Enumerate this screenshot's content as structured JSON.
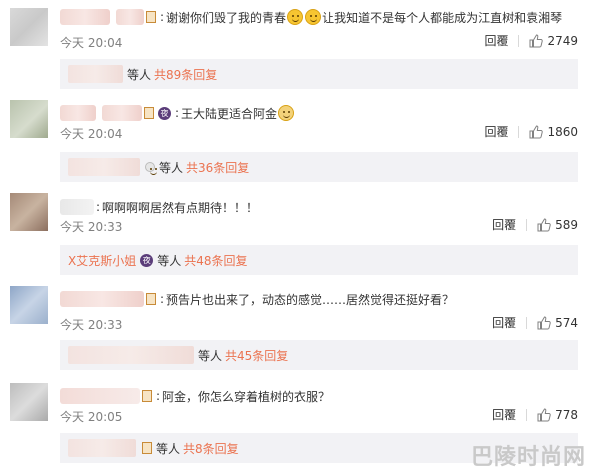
{
  "comments": [
    {
      "text": "谢谢你们毁了我的青春",
      "text2": "让我知道不是每个人都能成为江直树和袁湘琴",
      "time": "今天 20:04",
      "reply": "回覆",
      "likes": "2749",
      "sub_people": "等人",
      "sub_count": "共89条回复"
    },
    {
      "text": "王大陆更适合阿金",
      "time": "今天 20:04",
      "reply": "回覆",
      "likes": "1860",
      "sub_people": "等人",
      "sub_count": "共36条回复"
    },
    {
      "text": "啊啊啊啊居然有点期待！！！",
      "time": "今天 20:33",
      "reply": "回覆",
      "likes": "589",
      "sub_name": "X艾克斯小姐",
      "sub_people": "等人",
      "sub_count": "共48条回复"
    },
    {
      "text": "预告片也出来了，动态的感觉……居然觉得还挺好看？",
      "time": "今天 20:33",
      "reply": "回覆",
      "likes": "574",
      "sub_people": "等人",
      "sub_count": "共45条回复"
    },
    {
      "text": "阿金，你怎么穿着植树的衣服？",
      "time": "今天 20:05",
      "reply": "回覆",
      "likes": "778",
      "sub_people": "等人",
      "sub_count": "共8条回复"
    }
  ],
  "badge_text": "夜",
  "watermark": "巴陵时尚网",
  "colors": {
    "accent": "#eb7350",
    "muted": "#808080",
    "sub_bg": "#f2f2f5"
  },
  "icons": {
    "like": "thumbs-up-icon",
    "badge": "vip-badge-icon",
    "emoji": "smile-emoji-icon"
  }
}
